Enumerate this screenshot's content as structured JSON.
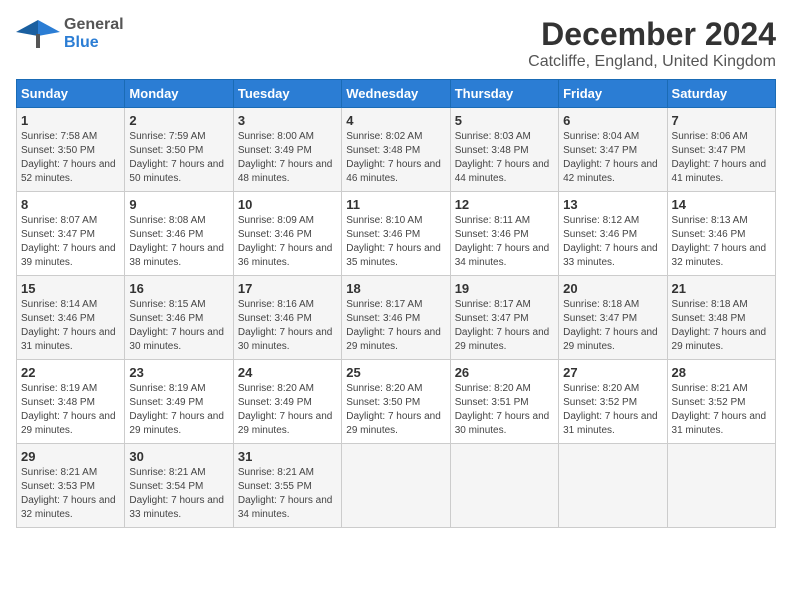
{
  "header": {
    "logo_general": "General",
    "logo_blue": "Blue",
    "month_year": "December 2024",
    "location": "Catcliffe, England, United Kingdom"
  },
  "days_of_week": [
    "Sunday",
    "Monday",
    "Tuesday",
    "Wednesday",
    "Thursday",
    "Friday",
    "Saturday"
  ],
  "weeks": [
    [
      {
        "day": "1",
        "sunrise": "Sunrise: 7:58 AM",
        "sunset": "Sunset: 3:50 PM",
        "daylight": "Daylight: 7 hours and 52 minutes."
      },
      {
        "day": "2",
        "sunrise": "Sunrise: 7:59 AM",
        "sunset": "Sunset: 3:50 PM",
        "daylight": "Daylight: 7 hours and 50 minutes."
      },
      {
        "day": "3",
        "sunrise": "Sunrise: 8:00 AM",
        "sunset": "Sunset: 3:49 PM",
        "daylight": "Daylight: 7 hours and 48 minutes."
      },
      {
        "day": "4",
        "sunrise": "Sunrise: 8:02 AM",
        "sunset": "Sunset: 3:48 PM",
        "daylight": "Daylight: 7 hours and 46 minutes."
      },
      {
        "day": "5",
        "sunrise": "Sunrise: 8:03 AM",
        "sunset": "Sunset: 3:48 PM",
        "daylight": "Daylight: 7 hours and 44 minutes."
      },
      {
        "day": "6",
        "sunrise": "Sunrise: 8:04 AM",
        "sunset": "Sunset: 3:47 PM",
        "daylight": "Daylight: 7 hours and 42 minutes."
      },
      {
        "day": "7",
        "sunrise": "Sunrise: 8:06 AM",
        "sunset": "Sunset: 3:47 PM",
        "daylight": "Daylight: 7 hours and 41 minutes."
      }
    ],
    [
      {
        "day": "8",
        "sunrise": "Sunrise: 8:07 AM",
        "sunset": "Sunset: 3:47 PM",
        "daylight": "Daylight: 7 hours and 39 minutes."
      },
      {
        "day": "9",
        "sunrise": "Sunrise: 8:08 AM",
        "sunset": "Sunset: 3:46 PM",
        "daylight": "Daylight: 7 hours and 38 minutes."
      },
      {
        "day": "10",
        "sunrise": "Sunrise: 8:09 AM",
        "sunset": "Sunset: 3:46 PM",
        "daylight": "Daylight: 7 hours and 36 minutes."
      },
      {
        "day": "11",
        "sunrise": "Sunrise: 8:10 AM",
        "sunset": "Sunset: 3:46 PM",
        "daylight": "Daylight: 7 hours and 35 minutes."
      },
      {
        "day": "12",
        "sunrise": "Sunrise: 8:11 AM",
        "sunset": "Sunset: 3:46 PM",
        "daylight": "Daylight: 7 hours and 34 minutes."
      },
      {
        "day": "13",
        "sunrise": "Sunrise: 8:12 AM",
        "sunset": "Sunset: 3:46 PM",
        "daylight": "Daylight: 7 hours and 33 minutes."
      },
      {
        "day": "14",
        "sunrise": "Sunrise: 8:13 AM",
        "sunset": "Sunset: 3:46 PM",
        "daylight": "Daylight: 7 hours and 32 minutes."
      }
    ],
    [
      {
        "day": "15",
        "sunrise": "Sunrise: 8:14 AM",
        "sunset": "Sunset: 3:46 PM",
        "daylight": "Daylight: 7 hours and 31 minutes."
      },
      {
        "day": "16",
        "sunrise": "Sunrise: 8:15 AM",
        "sunset": "Sunset: 3:46 PM",
        "daylight": "Daylight: 7 hours and 30 minutes."
      },
      {
        "day": "17",
        "sunrise": "Sunrise: 8:16 AM",
        "sunset": "Sunset: 3:46 PM",
        "daylight": "Daylight: 7 hours and 30 minutes."
      },
      {
        "day": "18",
        "sunrise": "Sunrise: 8:17 AM",
        "sunset": "Sunset: 3:46 PM",
        "daylight": "Daylight: 7 hours and 29 minutes."
      },
      {
        "day": "19",
        "sunrise": "Sunrise: 8:17 AM",
        "sunset": "Sunset: 3:47 PM",
        "daylight": "Daylight: 7 hours and 29 minutes."
      },
      {
        "day": "20",
        "sunrise": "Sunrise: 8:18 AM",
        "sunset": "Sunset: 3:47 PM",
        "daylight": "Daylight: 7 hours and 29 minutes."
      },
      {
        "day": "21",
        "sunrise": "Sunrise: 8:18 AM",
        "sunset": "Sunset: 3:48 PM",
        "daylight": "Daylight: 7 hours and 29 minutes."
      }
    ],
    [
      {
        "day": "22",
        "sunrise": "Sunrise: 8:19 AM",
        "sunset": "Sunset: 3:48 PM",
        "daylight": "Daylight: 7 hours and 29 minutes."
      },
      {
        "day": "23",
        "sunrise": "Sunrise: 8:19 AM",
        "sunset": "Sunset: 3:49 PM",
        "daylight": "Daylight: 7 hours and 29 minutes."
      },
      {
        "day": "24",
        "sunrise": "Sunrise: 8:20 AM",
        "sunset": "Sunset: 3:49 PM",
        "daylight": "Daylight: 7 hours and 29 minutes."
      },
      {
        "day": "25",
        "sunrise": "Sunrise: 8:20 AM",
        "sunset": "Sunset: 3:50 PM",
        "daylight": "Daylight: 7 hours and 29 minutes."
      },
      {
        "day": "26",
        "sunrise": "Sunrise: 8:20 AM",
        "sunset": "Sunset: 3:51 PM",
        "daylight": "Daylight: 7 hours and 30 minutes."
      },
      {
        "day": "27",
        "sunrise": "Sunrise: 8:20 AM",
        "sunset": "Sunset: 3:52 PM",
        "daylight": "Daylight: 7 hours and 31 minutes."
      },
      {
        "day": "28",
        "sunrise": "Sunrise: 8:21 AM",
        "sunset": "Sunset: 3:52 PM",
        "daylight": "Daylight: 7 hours and 31 minutes."
      }
    ],
    [
      {
        "day": "29",
        "sunrise": "Sunrise: 8:21 AM",
        "sunset": "Sunset: 3:53 PM",
        "daylight": "Daylight: 7 hours and 32 minutes."
      },
      {
        "day": "30",
        "sunrise": "Sunrise: 8:21 AM",
        "sunset": "Sunset: 3:54 PM",
        "daylight": "Daylight: 7 hours and 33 minutes."
      },
      {
        "day": "31",
        "sunrise": "Sunrise: 8:21 AM",
        "sunset": "Sunset: 3:55 PM",
        "daylight": "Daylight: 7 hours and 34 minutes."
      },
      null,
      null,
      null,
      null
    ]
  ]
}
